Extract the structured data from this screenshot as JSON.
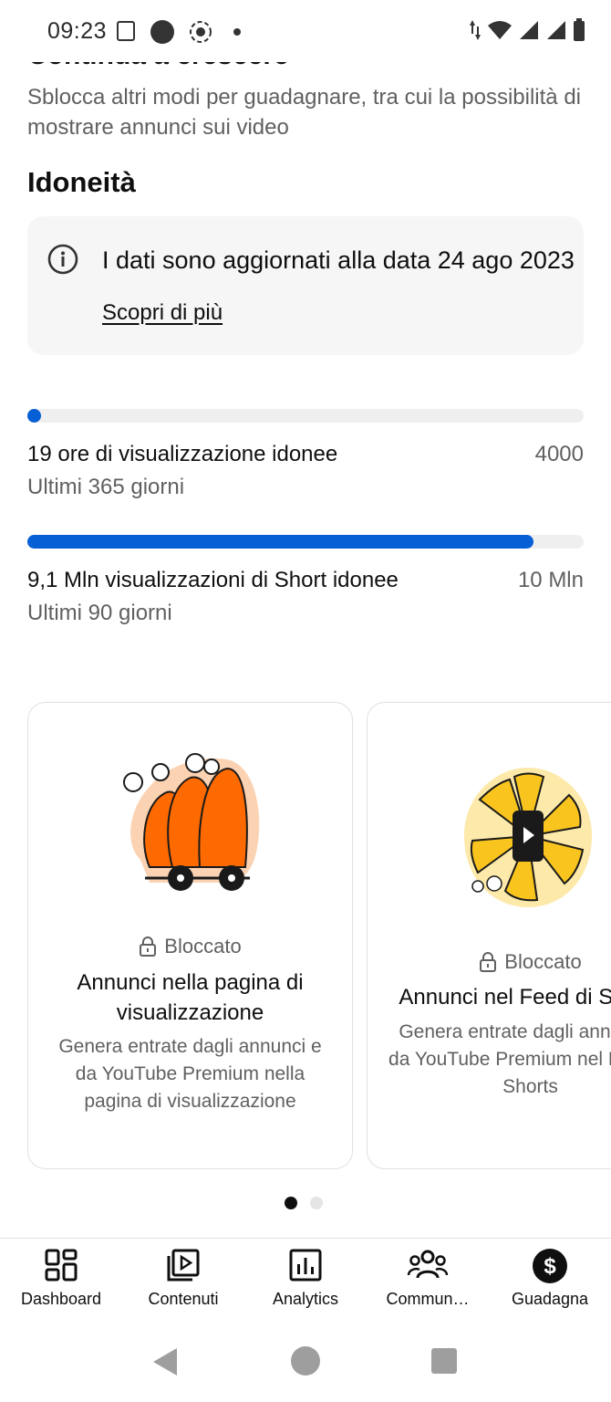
{
  "status_bar": {
    "time": "09:23",
    "icons_left": [
      "screen-icon",
      "circle-icon",
      "record-icon",
      "dot-icon"
    ],
    "icons_right": [
      "data-arrows-icon",
      "wifi-icon",
      "signal-icon",
      "signal-icon",
      "battery-icon"
    ]
  },
  "header": {
    "clipped_title": "Continua a crescere",
    "subtitle": "Sblocca altri modi per guadagnare, tra cui la possibilità di mostrare annunci sui video"
  },
  "eligibility": {
    "title": "Idoneità",
    "info_text": "I dati sono aggiornati alla data 24 ago 2023",
    "info_link": "Scopri di più",
    "metrics": [
      {
        "label": "19 ore di visualizzazione idonee",
        "target": "4000",
        "period": "Ultimi 365 giorni",
        "progress": 0.005
      },
      {
        "label": "9,1 Mln visualizzazioni di Short idonee",
        "target": "10 Mln",
        "period": "Ultimi 90 giorni",
        "progress": 0.91
      }
    ]
  },
  "cards": [
    {
      "status": "Bloccato",
      "title": "Annunci nella pagina di visualizzazione",
      "description": "Genera entrate dagli annunci e da YouTube Premium nella pagina di visualizzazione"
    },
    {
      "status": "Bloccato",
      "title": "Annunci nel Feed di Shorts",
      "description": "Genera entrate dagli annunci e da YouTube Premium nel Feed di Shorts"
    }
  ],
  "pager": {
    "count": 2,
    "active": 0
  },
  "bottom_nav": [
    {
      "label": "Dashboard",
      "icon": "dashboard-icon"
    },
    {
      "label": "Contenuti",
      "icon": "content-icon"
    },
    {
      "label": "Analytics",
      "icon": "analytics-icon"
    },
    {
      "label": "Commun…",
      "icon": "community-icon"
    },
    {
      "label": "Guadagna",
      "icon": "earn-icon"
    }
  ],
  "colors": {
    "accent": "#065fd4",
    "orange": "#ff6a00",
    "yellow": "#f9c41e"
  }
}
